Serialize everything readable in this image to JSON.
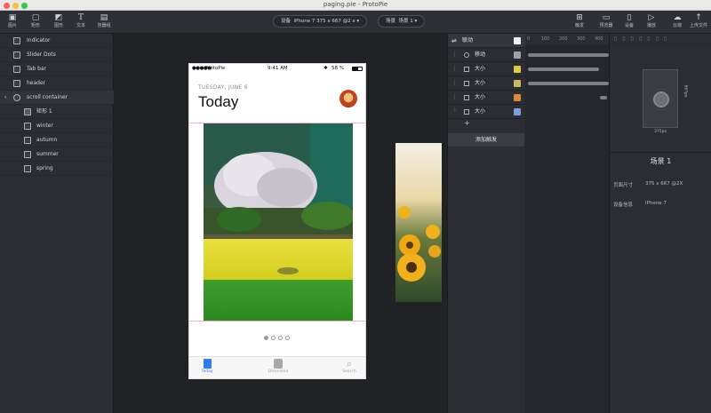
{
  "window": {
    "title": "paging.pie - ProtoPie"
  },
  "toolbar": {
    "tools": [
      {
        "label": "图片",
        "icon": "image-icon"
      },
      {
        "label": "矩形",
        "icon": "rectangle-icon"
      },
      {
        "label": "图形",
        "icon": "shapes-icon"
      },
      {
        "label": "文本",
        "icon": "text-icon"
      },
      {
        "label": "容器组",
        "icon": "container-icon"
      }
    ],
    "device_label": "设备",
    "device_value": "iPhone 7  375 x 667  @2 x",
    "scene_label": "场景",
    "scene_value": "场景 1",
    "right_tools": [
      {
        "label": "触发",
        "icon": "trigger-icon"
      },
      {
        "label": "预览器",
        "icon": "preview-icon"
      },
      {
        "label": "设备",
        "icon": "device-icon"
      },
      {
        "label": "播放",
        "icon": "play-icon"
      },
      {
        "label": "云端",
        "icon": "cloud-icon"
      },
      {
        "label": "上传文件",
        "icon": "upload-icon"
      }
    ]
  },
  "layers": [
    {
      "name": "Indicator",
      "indent": 0,
      "type": "image"
    },
    {
      "name": "Slider Dots",
      "indent": 0,
      "type": "image"
    },
    {
      "name": "Tab bar",
      "indent": 0,
      "type": "image"
    },
    {
      "name": "header",
      "indent": 0,
      "type": "image"
    },
    {
      "name": "scroll container",
      "indent": 0,
      "type": "container"
    },
    {
      "name": "矩形 1",
      "indent": 1,
      "type": "rect"
    },
    {
      "name": "winter",
      "indent": 1,
      "type": "image"
    },
    {
      "name": "autumn",
      "indent": 1,
      "type": "image"
    },
    {
      "name": "summer",
      "indent": 1,
      "type": "image"
    },
    {
      "name": "spring",
      "indent": 1,
      "type": "image"
    }
  ],
  "phone": {
    "carrier": "ProtoPie",
    "time": "9:41 AM",
    "battery": "58 %",
    "date": "TUESDAY, JUNE 6",
    "heading": "Today",
    "tabs": [
      {
        "label": "Today",
        "active": true
      },
      {
        "label": "Download",
        "active": false
      },
      {
        "label": "Search",
        "active": false
      }
    ],
    "page_count": 4,
    "current_page": 1
  },
  "triggers": {
    "header": "联动",
    "responses": [
      {
        "label": "移动",
        "thumb_color": "#9da1a9"
      },
      {
        "label": "大小",
        "thumb_color": "#e6c542"
      },
      {
        "label": "大小",
        "thumb_color": "#c9b86a"
      },
      {
        "label": "大小",
        "thumb_color": "#d78b3b"
      },
      {
        "label": "大小",
        "thumb_color": "#7aa0d8"
      }
    ],
    "add_symbol": "+",
    "add_button": "添加触发"
  },
  "timeline": {
    "ruler": [
      "0",
      "100",
      "200",
      "300",
      "400"
    ]
  },
  "properties": {
    "width_label": "375px",
    "height_label": "667px",
    "scene_title": "场景 1",
    "page_size_label": "页面尺寸",
    "page_size_value": "375 x 667 @2X",
    "device_label": "设备信息",
    "device_value": "iPhone 7"
  },
  "colors": {
    "accent": "#3b82f6",
    "panel": "#2b2d33",
    "canvas": "#202226"
  }
}
